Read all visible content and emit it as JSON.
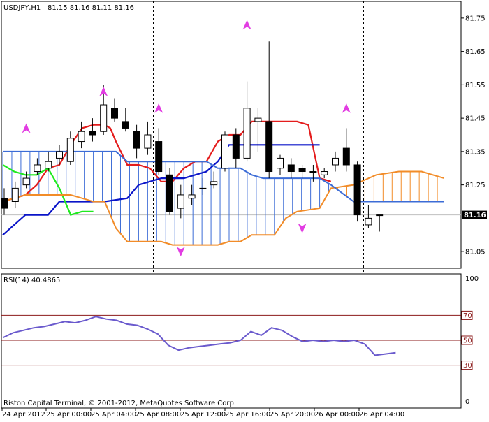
{
  "header": {
    "symbol": "USDJPY,H1",
    "ohlc": "81.15 81.16 81.11 81.16"
  },
  "footer": {
    "copyright": "Riston Capital Terminal, © 2001-2012, MetaQuotes Software Corp."
  },
  "chart_data": [
    {
      "type": "candlestick",
      "title": "USDJPY,H1",
      "ylim": [
        81.0,
        81.8
      ],
      "y_ticks": [
        "81.75",
        "81.65",
        "81.55",
        "81.45",
        "81.35",
        "81.25",
        "81.05"
      ],
      "current_price": "81.16",
      "x_tick_labels": [
        "24 Apr 2012",
        "25 Apr 00:00",
        "25 Apr 04:00",
        "25 Apr 08:00",
        "25 Apr 12:00",
        "25 Apr 16:00",
        "25 Apr 20:00",
        "26 Apr 00:00",
        "26 Apr 04:00"
      ],
      "candles": [
        {
          "i": 0,
          "o": 81.21,
          "h": 81.24,
          "l": 81.16,
          "c": 81.18
        },
        {
          "i": 1,
          "o": 81.2,
          "h": 81.26,
          "l": 81.18,
          "c": 81.24
        },
        {
          "i": 2,
          "o": 81.25,
          "h": 81.29,
          "l": 81.24,
          "c": 81.27
        },
        {
          "i": 3,
          "o": 81.29,
          "h": 81.33,
          "l": 81.28,
          "c": 81.31
        },
        {
          "i": 4,
          "o": 81.3,
          "h": 81.35,
          "l": 81.29,
          "c": 81.32
        },
        {
          "i": 5,
          "o": 81.33,
          "h": 81.37,
          "l": 81.31,
          "c": 81.35
        },
        {
          "i": 6,
          "o": 81.32,
          "h": 81.41,
          "l": 81.31,
          "c": 81.39
        },
        {
          "i": 7,
          "o": 81.38,
          "h": 81.44,
          "l": 81.36,
          "c": 81.41
        },
        {
          "i": 8,
          "o": 81.41,
          "h": 81.45,
          "l": 81.38,
          "c": 81.4
        },
        {
          "i": 9,
          "o": 81.41,
          "h": 81.55,
          "l": 81.4,
          "c": 81.49
        },
        {
          "i": 10,
          "o": 81.48,
          "h": 81.51,
          "l": 81.44,
          "c": 81.45
        },
        {
          "i": 11,
          "o": 81.44,
          "h": 81.48,
          "l": 81.41,
          "c": 81.42
        },
        {
          "i": 12,
          "o": 81.41,
          "h": 81.43,
          "l": 81.33,
          "c": 81.36
        },
        {
          "i": 13,
          "o": 81.36,
          "h": 81.44,
          "l": 81.34,
          "c": 81.4
        },
        {
          "i": 14,
          "o": 81.38,
          "h": 81.42,
          "l": 81.28,
          "c": 81.29
        },
        {
          "i": 15,
          "o": 81.28,
          "h": 81.3,
          "l": 81.16,
          "c": 81.17
        },
        {
          "i": 16,
          "o": 81.18,
          "h": 81.25,
          "l": 81.15,
          "c": 81.22
        },
        {
          "i": 17,
          "o": 81.21,
          "h": 81.25,
          "l": 81.19,
          "c": 81.22
        },
        {
          "i": 18,
          "o": 81.24,
          "h": 81.27,
          "l": 81.22,
          "c": 81.24
        },
        {
          "i": 19,
          "o": 81.25,
          "h": 81.29,
          "l": 81.24,
          "c": 81.26
        },
        {
          "i": 20,
          "o": 81.3,
          "h": 81.41,
          "l": 81.29,
          "c": 81.4
        },
        {
          "i": 21,
          "o": 81.4,
          "h": 81.42,
          "l": 81.3,
          "c": 81.33
        },
        {
          "i": 22,
          "o": 81.33,
          "h": 81.56,
          "l": 81.32,
          "c": 81.48
        },
        {
          "i": 23,
          "o": 81.44,
          "h": 81.48,
          "l": 81.35,
          "c": 81.45
        },
        {
          "i": 24,
          "o": 81.44,
          "h": 81.68,
          "l": 81.27,
          "c": 81.29
        },
        {
          "i": 25,
          "o": 81.3,
          "h": 81.34,
          "l": 81.28,
          "c": 81.33
        },
        {
          "i": 26,
          "o": 81.31,
          "h": 81.33,
          "l": 81.27,
          "c": 81.29
        },
        {
          "i": 27,
          "o": 81.3,
          "h": 81.31,
          "l": 81.27,
          "c": 81.29
        },
        {
          "i": 28,
          "o": 81.29,
          "h": 81.31,
          "l": 81.26,
          "c": 81.29
        },
        {
          "i": 29,
          "o": 81.28,
          "h": 81.3,
          "l": 81.27,
          "c": 81.29
        },
        {
          "i": 30,
          "o": 81.31,
          "h": 81.35,
          "l": 81.29,
          "c": 81.33
        },
        {
          "i": 31,
          "o": 81.36,
          "h": 81.42,
          "l": 81.29,
          "c": 81.31
        },
        {
          "i": 32,
          "o": 81.31,
          "h": 81.32,
          "l": 81.14,
          "c": 81.16
        },
        {
          "i": 33,
          "o": 81.13,
          "h": 81.19,
          "l": 81.12,
          "c": 81.15
        },
        {
          "i": 34,
          "o": 81.16,
          "h": 81.16,
          "l": 81.11,
          "c": 81.16
        }
      ],
      "series": [
        {
          "name": "",
          "color": "#e41c1c",
          "values": [
            [
              0,
              81.2
            ],
            [
              2,
              81.21
            ],
            [
              4,
              81.22
            ],
            [
              6,
              81.25
            ],
            [
              8,
              81.3
            ],
            [
              10,
              81.31
            ],
            [
              12,
              81.37
            ],
            [
              14,
              81.42
            ],
            [
              16,
              81.43
            ],
            [
              18,
              81.43
            ],
            [
              19,
              81.42
            ],
            [
              20,
              81.38
            ],
            [
              22,
              81.31
            ],
            [
              24,
              81.31
            ],
            [
              26,
              81.3
            ],
            [
              28,
              81.26
            ],
            [
              30,
              81.26
            ],
            [
              32,
              81.3
            ],
            [
              34,
              81.32
            ],
            [
              36,
              81.32
            ],
            [
              38,
              81.38
            ],
            [
              40,
              81.4
            ],
            [
              42,
              81.4
            ],
            [
              44,
              81.44
            ],
            [
              46,
              81.44
            ],
            [
              48,
              81.44
            ],
            [
              52,
              81.44
            ],
            [
              54,
              81.43
            ],
            [
              56,
              81.27
            ],
            [
              58,
              81.26
            ]
          ]
        },
        {
          "name": "",
          "color": "#0a14c8",
          "values": [
            [
              0,
              81.1
            ],
            [
              4,
              81.16
            ],
            [
              8,
              81.16
            ],
            [
              10,
              81.2
            ],
            [
              14,
              81.2
            ],
            [
              18,
              81.2
            ],
            [
              22,
              81.21
            ],
            [
              24,
              81.25
            ],
            [
              28,
              81.27
            ],
            [
              30,
              81.27
            ],
            [
              32,
              81.27
            ],
            [
              34,
              81.28
            ],
            [
              36,
              81.29
            ],
            [
              38,
              81.32
            ],
            [
              40,
              81.37
            ],
            [
              44,
              81.37
            ],
            [
              52,
              81.37
            ],
            [
              56,
              81.37
            ]
          ]
        },
        {
          "name": "",
          "color": "#1eea1e",
          "values": [
            [
              0,
              81.31
            ],
            [
              2,
              81.29
            ],
            [
              4,
              81.28
            ],
            [
              6,
              81.28
            ],
            [
              8,
              81.3
            ],
            [
              10,
              81.24
            ],
            [
              12,
              81.16
            ],
            [
              14,
              81.17
            ],
            [
              16,
              81.17
            ]
          ]
        },
        {
          "name": "",
          "color": "#f28c28",
          "values": [
            [
              0,
              81.2
            ],
            [
              2,
              81.21
            ],
            [
              4,
              81.22
            ],
            [
              6,
              81.22
            ],
            [
              8,
              81.22
            ],
            [
              10,
              81.22
            ],
            [
              12,
              81.22
            ],
            [
              14,
              81.21
            ],
            [
              16,
              81.2
            ],
            [
              18,
              81.2
            ],
            [
              20,
              81.12
            ],
            [
              22,
              81.08
            ],
            [
              24,
              81.08
            ],
            [
              26,
              81.08
            ],
            [
              28,
              81.08
            ],
            [
              30,
              81.07
            ],
            [
              34,
              81.07
            ],
            [
              36,
              81.07
            ],
            [
              38,
              81.07
            ],
            [
              40,
              81.08
            ],
            [
              42,
              81.08
            ],
            [
              44,
              81.1
            ],
            [
              46,
              81.1
            ],
            [
              48,
              81.1
            ],
            [
              50,
              81.15
            ],
            [
              52,
              81.17
            ],
            [
              56,
              81.18
            ],
            [
              58,
              81.24
            ],
            [
              62,
              81.25
            ],
            [
              66,
              81.28
            ],
            [
              70,
              81.29
            ],
            [
              72,
              81.29
            ],
            [
              74,
              81.29
            ],
            [
              78,
              81.27
            ]
          ]
        },
        {
          "name": "",
          "color": "#3c6cd6",
          "values": [
            [
              0,
              81.35
            ],
            [
              4,
              81.35
            ],
            [
              8,
              81.35
            ],
            [
              12,
              81.35
            ],
            [
              16,
              81.35
            ],
            [
              20,
              81.35
            ],
            [
              22,
              81.32
            ],
            [
              24,
              81.32
            ],
            [
              26,
              81.32
            ],
            [
              28,
              81.32
            ],
            [
              30,
              81.32
            ],
            [
              32,
              81.32
            ],
            [
              34,
              81.32
            ],
            [
              36,
              81.32
            ],
            [
              38,
              81.3
            ],
            [
              40,
              81.3
            ],
            [
              42,
              81.3
            ],
            [
              44,
              81.28
            ],
            [
              46,
              81.27
            ],
            [
              48,
              81.27
            ],
            [
              52,
              81.27
            ],
            [
              56,
              81.27
            ],
            [
              58,
              81.25
            ],
            [
              62,
              81.2
            ],
            [
              70,
              81.2
            ],
            [
              78,
              81.2
            ]
          ]
        }
      ],
      "fractals_up": [
        [
          2,
          81.42
        ],
        [
          9,
          81.53
        ],
        [
          14,
          81.48
        ],
        [
          22,
          81.73
        ],
        [
          31,
          81.48
        ]
      ],
      "fractals_down": [
        [
          16,
          81.05
        ],
        [
          27,
          81.12
        ]
      ],
      "vlines_at": [
        3,
        12,
        27,
        31
      ],
      "ref_hline_at": 81.16
    },
    {
      "type": "line",
      "title": "RSI(14) 40.4865",
      "ylim": [
        0,
        100
      ],
      "y_ticks_labels": [
        "100",
        "0"
      ],
      "levels": [
        "70",
        "50",
        "30"
      ],
      "series": [
        {
          "name": "RSI(14)",
          "color": "#6a5acd",
          "values": [
            [
              0,
              52
            ],
            [
              1,
              56
            ],
            [
              2,
              58
            ],
            [
              3,
              60
            ],
            [
              4,
              61
            ],
            [
              5,
              63
            ],
            [
              6,
              65
            ],
            [
              7,
              64
            ],
            [
              8,
              66
            ],
            [
              9,
              69
            ],
            [
              10,
              67
            ],
            [
              11,
              66
            ],
            [
              12,
              63
            ],
            [
              13,
              62
            ],
            [
              14,
              59
            ],
            [
              15,
              55
            ],
            [
              16,
              46
            ],
            [
              17,
              42
            ],
            [
              18,
              44
            ],
            [
              19,
              45
            ],
            [
              20,
              46
            ],
            [
              21,
              47
            ],
            [
              22,
              48
            ],
            [
              23,
              50
            ],
            [
              24,
              57
            ],
            [
              25,
              54
            ],
            [
              26,
              60
            ],
            [
              27,
              58
            ],
            [
              28,
              53
            ],
            [
              29,
              49
            ],
            [
              30,
              50
            ],
            [
              31,
              49
            ],
            [
              32,
              50
            ],
            [
              33,
              49
            ],
            [
              34,
              50
            ],
            [
              35,
              47
            ],
            [
              36,
              38
            ],
            [
              37,
              39
            ],
            [
              38,
              40
            ]
          ]
        }
      ]
    }
  ]
}
